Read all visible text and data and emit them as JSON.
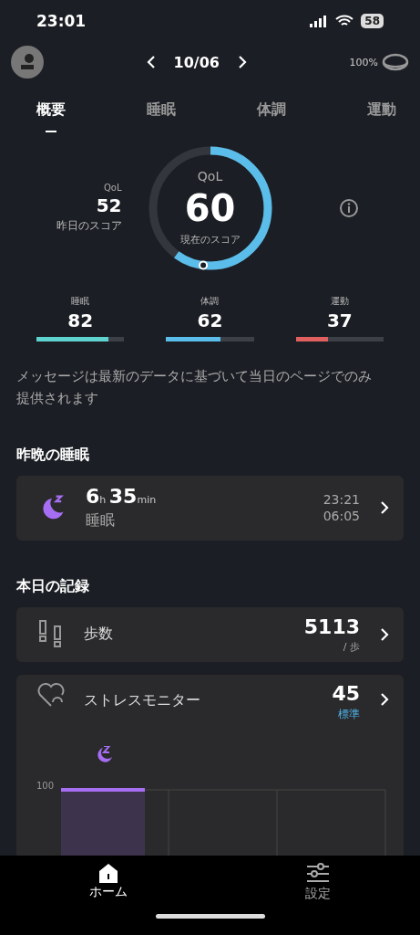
{
  "status_bar": {
    "time": "23:01",
    "battery": "58"
  },
  "header": {
    "date": "10/06",
    "ring_battery": "100%"
  },
  "tabs": [
    {
      "label": "概要",
      "selected": true
    },
    {
      "label": "睡眠",
      "selected": false
    },
    {
      "label": "体調",
      "selected": false
    },
    {
      "label": "運動",
      "selected": false
    }
  ],
  "qol": {
    "label": "QoL",
    "score": "60",
    "caption": "現在のスコア",
    "yesterday": {
      "label": "QoL",
      "score": "52",
      "caption": "昨日のスコア"
    }
  },
  "subscores": [
    {
      "label": "睡眠",
      "score": "82",
      "level": 0.82,
      "color": "#5fd3cf"
    },
    {
      "label": "体調",
      "score": "62",
      "level": 0.62,
      "color": "#5bbde9"
    },
    {
      "label": "運動",
      "score": "37",
      "level": 0.37,
      "color": "#e06060"
    }
  ],
  "message": "メッセージは最新のデータに基づいて当日のページでのみ提供されます",
  "last_night": {
    "title": "昨晩の睡眠",
    "hours": "6",
    "hours_unit": "h",
    "minutes": "35",
    "minutes_unit": "min",
    "label": "睡眠",
    "start": "23:21",
    "end": "06:05"
  },
  "today": {
    "title": "本日の記録",
    "steps": {
      "label": "歩数",
      "value": "5113",
      "unit": "/ 歩"
    },
    "stress": {
      "label": "ストレスモニター",
      "value": "45",
      "status": "標準",
      "y_tick": "100"
    }
  },
  "nav": [
    {
      "label": "ホーム",
      "selected": true
    },
    {
      "label": "設定",
      "selected": false
    }
  ]
}
